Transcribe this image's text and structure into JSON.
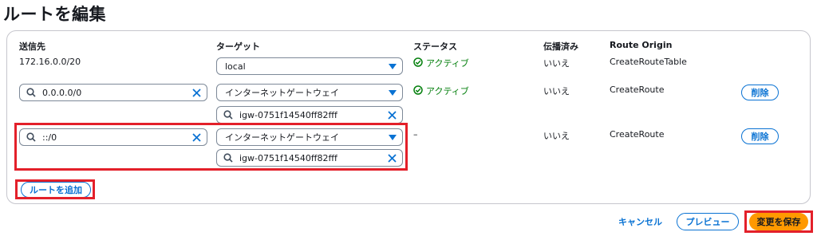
{
  "page": {
    "title": "ルートを編集"
  },
  "table": {
    "headers": {
      "destination": "送信先",
      "target": "ターゲット",
      "status": "ステータス",
      "propagated": "伝播済み",
      "origin": "Route Origin"
    },
    "rows": [
      {
        "destination": "172.16.0.0/20",
        "target": "local",
        "status": "アクティブ",
        "propagated": "いいえ",
        "origin": "CreateRouteTable"
      },
      {
        "destination": "0.0.0.0/0",
        "target": "インターネットゲートウェイ",
        "target_id": "igw-0751f14540ff82fff",
        "status": "アクティブ",
        "propagated": "いいえ",
        "origin": "CreateRoute",
        "remove_label": "削除"
      },
      {
        "destination": "::/0",
        "target": "インターネットゲートウェイ",
        "target_id": "igw-0751f14540ff82fff",
        "status": "–",
        "propagated": "いいえ",
        "origin": "CreateRoute",
        "remove_label": "削除"
      }
    ],
    "add_route_label": "ルートを追加"
  },
  "footer": {
    "cancel_label": "キャンセル",
    "preview_label": "プレビュー",
    "save_label": "変更を保存"
  },
  "colors": {
    "link_blue": "#0972d3",
    "status_green": "#037f0c",
    "highlight_red": "#e3202a",
    "primary_orange": "#ff9900"
  },
  "icons": {
    "search": "search-icon",
    "clear": "close-icon",
    "dropdown": "caret-down-icon",
    "status_ok": "check-circle-icon"
  }
}
